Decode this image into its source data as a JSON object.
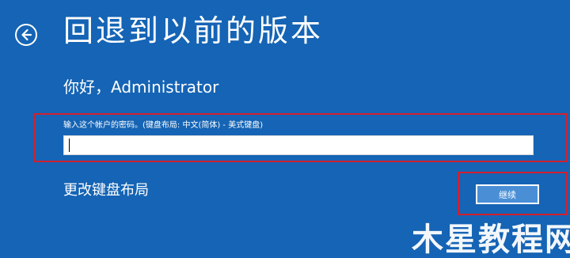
{
  "page": {
    "title": "回退到以前的版本",
    "greeting": "你好，Administrator"
  },
  "password": {
    "label": "输入这个帐户的密码。(键盘布局: 中文(简体) - 美式键盘)",
    "value": ""
  },
  "actions": {
    "change_layout_label": "更改键盘布局",
    "continue_label": "继续"
  },
  "watermark": {
    "text": "木星教程网"
  },
  "colors": {
    "background": "#1564b5",
    "highlight": "#d3202e",
    "button": "#4a8fd6"
  },
  "icons": {
    "back": "back-arrow-circle-icon"
  }
}
